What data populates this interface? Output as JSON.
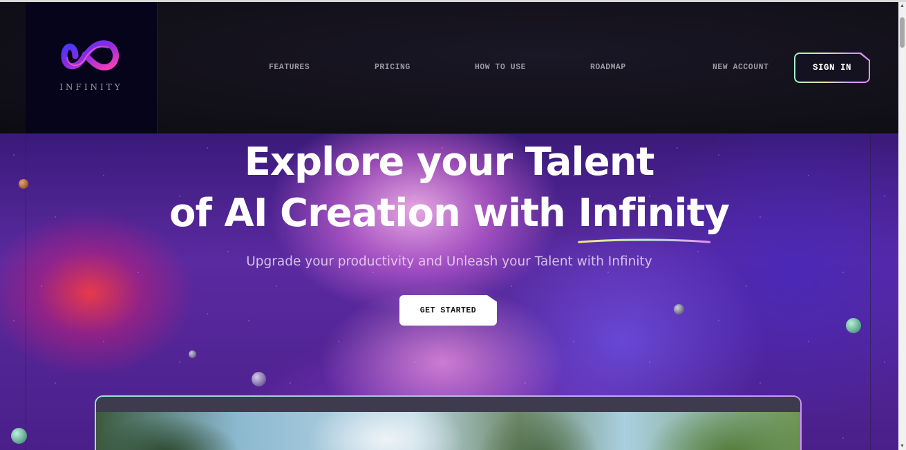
{
  "brand": {
    "name": "INFINITY"
  },
  "nav": {
    "items": [
      {
        "label": "FEATURES"
      },
      {
        "label": "PRICING"
      },
      {
        "label": "HOW TO USE"
      },
      {
        "label": "ROADMAP"
      },
      {
        "label": "NEW ACCOUNT"
      }
    ],
    "signin_label": "SIGN IN"
  },
  "hero": {
    "title_line1": "Explore your Talent",
    "title_line2_prefix": "of AI Creation with ",
    "title_highlight": "Infinity",
    "subtitle": "Upgrade your productivity and Unleash your Talent with Infinity",
    "cta_label": "GET STARTED"
  },
  "colors": {
    "header_bg": "#121019",
    "logo_bg": "#05041a",
    "hero_purple": "#5a2aa0",
    "accent_gradient": [
      "#a7f0d0",
      "#e6e3a8",
      "#c9a0ff",
      "#f08ff0"
    ],
    "cta_bg": "#ffffff"
  },
  "icons": {
    "logo": "infinity-logo-icon",
    "scroll_up": "scroll-up-arrow-icon",
    "scroll_down": "scroll-down-arrow-icon"
  }
}
